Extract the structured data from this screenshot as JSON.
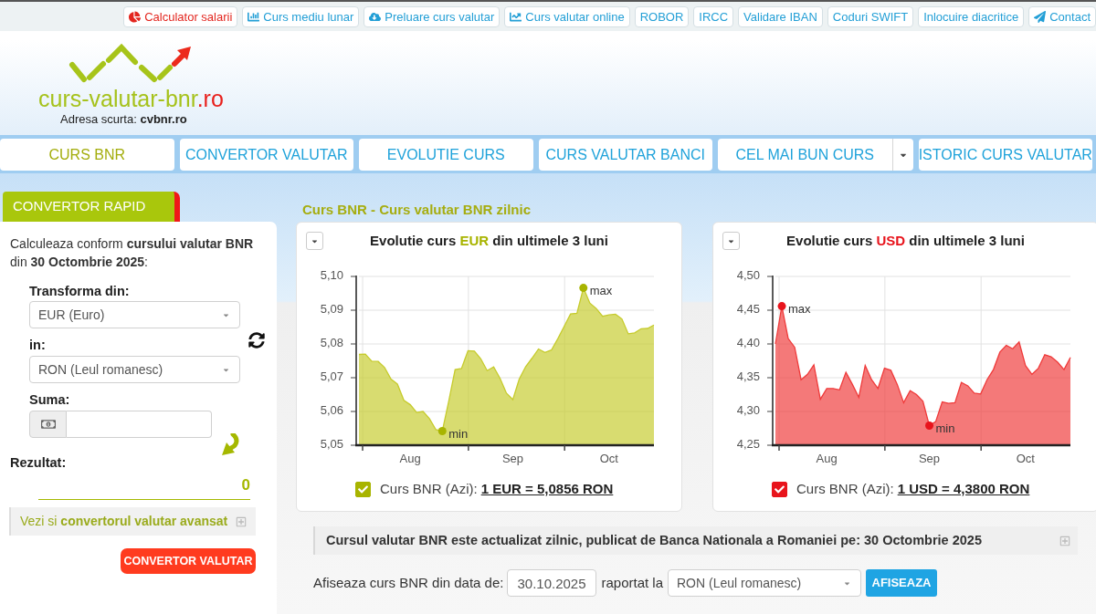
{
  "top_links": [
    {
      "label": "Calculator salarii",
      "kind": "salary",
      "color": "#e3261f"
    },
    {
      "label": "Curs mediu lunar",
      "kind": "average",
      "color": "#239fd6"
    },
    {
      "label": "Preluare curs valutar",
      "kind": "download",
      "color": "#239fd6"
    },
    {
      "label": "Curs valutar online",
      "kind": "online",
      "color": "#239fd6"
    },
    {
      "label": "ROBOR",
      "kind": "plain",
      "color": "#239fd6"
    },
    {
      "label": "IRCC",
      "kind": "plain",
      "color": "#239fd6"
    },
    {
      "label": "Validare IBAN",
      "kind": "plain",
      "color": "#239fd6"
    },
    {
      "label": "Coduri SWIFT",
      "kind": "plain",
      "color": "#239fd6"
    },
    {
      "label": "Inlocuire diacritice",
      "kind": "plain",
      "color": "#239fd6"
    },
    {
      "label": "Contact",
      "kind": "contact",
      "color": "#239fd6"
    }
  ],
  "header": {
    "logo_name": "curs-valutar-bnr",
    "logo_tld": ".ro",
    "short_address": "Adresa scurta: **cvbnr.ro**"
  },
  "tabs": [
    {
      "label": "CURS BNR",
      "kind": "tab",
      "selected": true
    },
    {
      "label": "CONVERTOR VALUTAR",
      "kind": "tab",
      "selected": false
    },
    {
      "label": "EVOLUTIE CURS",
      "kind": "tab",
      "selected": false
    },
    {
      "label": "CURS VALUTAR BANCI",
      "kind": "tab",
      "selected": false
    },
    {
      "label": "CEL MAI BUN CURS",
      "kind": "dropdown",
      "selected": false
    },
    {
      "label": "ISTORIC CURS VALUTAR",
      "kind": "tab",
      "selected": false
    }
  ],
  "quick_converter": {
    "tab": "CONVERTOR RAPID",
    "intro": "Calculeaza conform **cursului valutar BNR** din **30 Octombrie 2025**:",
    "from_label": "Transforma din:",
    "from_value": "EUR (Euro)",
    "to_label": "in:",
    "to_value": "RON (Leul romanesc)",
    "amount_label": "Suma:",
    "result_label": "Rezultat:",
    "result_value": "0",
    "advanced_link": "Vezi si **convertorul valutar avansat**",
    "button": "CONVERTOR VALUTAR"
  },
  "section_title": "Curs BNR - Curs valutar BNR zilnic",
  "charts": [
    {
      "title_before": "Evolutie curs",
      "title_after": "din ultimele 3 luni",
      "color": "#a8b400",
      "legend_checked": true,
      "legend_label": "Curs BNR (Azi):",
      "legend_value": "1 EUR = 5,0856 RON",
      "chart_data": {
        "type": "area",
        "grid": true,
        "categories": [
          null,
          null,
          null,
          null,
          null,
          null,
          null,
          null,
          "Aug",
          null,
          null,
          null,
          null,
          null,
          null,
          null,
          null,
          null,
          null,
          null,
          null,
          null,
          null,
          null,
          "Sep",
          null,
          null,
          null,
          null,
          null,
          null,
          null,
          null,
          null,
          null,
          null,
          null,
          null,
          null,
          "Oct",
          null,
          null,
          null,
          null,
          null,
          null,
          null
        ],
        "series": [
          {
            "name": "EUR",
            "color": "#c6cb2c",
            "values": [
              5.0769,
              5.077,
              5.0749,
              5.0748,
              5.073,
              5.0696,
              5.0681,
              5.0633,
              5.062,
              5.0597,
              5.06,
              5.0579,
              5.0546,
              5.0542,
              5.063,
              5.0724,
              5.0727,
              5.078,
              5.0779,
              5.0756,
              5.0721,
              5.0732,
              5.0698,
              5.0654,
              5.0635,
              5.0696,
              5.0733,
              5.0758,
              5.0785,
              5.0775,
              5.0782,
              5.0815,
              5.0852,
              5.0889,
              5.0891,
              5.0966,
              5.0921,
              5.0905,
              5.0882,
              5.0886,
              5.0888,
              5.0874,
              5.083,
              5.0833,
              5.0845,
              5.0846,
              5.0856
            ]
          }
        ],
        "ylim": [
          5.05,
          5.1
        ],
        "yticks": [
          {
            "value": 5.05,
            "label": "5,05"
          },
          {
            "value": 5.06,
            "label": "5,06"
          },
          {
            "value": 5.07,
            "label": "5,07"
          },
          {
            "value": 5.08,
            "label": "5,08"
          },
          {
            "value": 5.09,
            "label": "5,09"
          },
          {
            "value": 5.1,
            "label": "5,10"
          }
        ],
        "annotations": [
          "max",
          "min"
        ]
      }
    },
    {
      "title_before": "Evolutie curs",
      "title_after": "din ultimele 3 luni",
      "color": "#e8141c",
      "legend_checked": true,
      "legend_label": "Curs BNR (Azi):",
      "legend_value": "1 USD = 4,3800 RON",
      "chart_data": {
        "type": "area",
        "grid": true,
        "categories": [
          null,
          null,
          null,
          null,
          null,
          null,
          null,
          null,
          "Aug",
          null,
          null,
          null,
          null,
          null,
          null,
          null,
          null,
          null,
          null,
          null,
          null,
          null,
          null,
          null,
          "Sep",
          null,
          null,
          null,
          null,
          null,
          null,
          null,
          null,
          null,
          null,
          null,
          null,
          null,
          null,
          "Oct",
          null,
          null,
          null,
          null,
          null,
          null,
          null
        ],
        "series": [
          {
            "name": "USD",
            "color": "#ef3a3a",
            "values": [
              4.4,
              4.456,
              4.408,
              4.395,
              4.347,
              4.355,
              4.369,
              4.318,
              4.334,
              4.334,
              4.332,
              4.358,
              4.34,
              4.321,
              4.368,
              4.347,
              4.334,
              4.364,
              4.361,
              4.34,
              4.313,
              4.331,
              4.325,
              4.315,
              4.279,
              4.285,
              4.314,
              4.312,
              4.313,
              4.343,
              4.338,
              4.327,
              4.326,
              4.347,
              4.362,
              4.388,
              4.398,
              4.393,
              4.403,
              4.368,
              4.355,
              4.364,
              4.384,
              4.381,
              4.373,
              4.362,
              4.38
            ]
          }
        ],
        "ylim": [
          4.25,
          4.5
        ],
        "yticks": [
          {
            "value": 4.25,
            "label": "4,25"
          },
          {
            "value": 4.3,
            "label": "4,30"
          },
          {
            "value": 4.35,
            "label": "4,35"
          },
          {
            "value": 4.4,
            "label": "4,40"
          },
          {
            "value": 4.45,
            "label": "4,45"
          },
          {
            "value": 4.5,
            "label": "4,50"
          }
        ],
        "annotations": [
          "max",
          "min"
        ]
      }
    }
  ],
  "update_notice": "Cursul valutar BNR este actualizat zilnic, publicat de Banca Nationala a Romaniei pe: 30 Octombrie 2025",
  "date_form": {
    "label": "Afiseaza curs BNR din data de:",
    "date_value": "30.10.2025",
    "relative_label": "raportat la",
    "currency_value": "RON (Leul romanesc)",
    "button": "AFISEAZA"
  }
}
